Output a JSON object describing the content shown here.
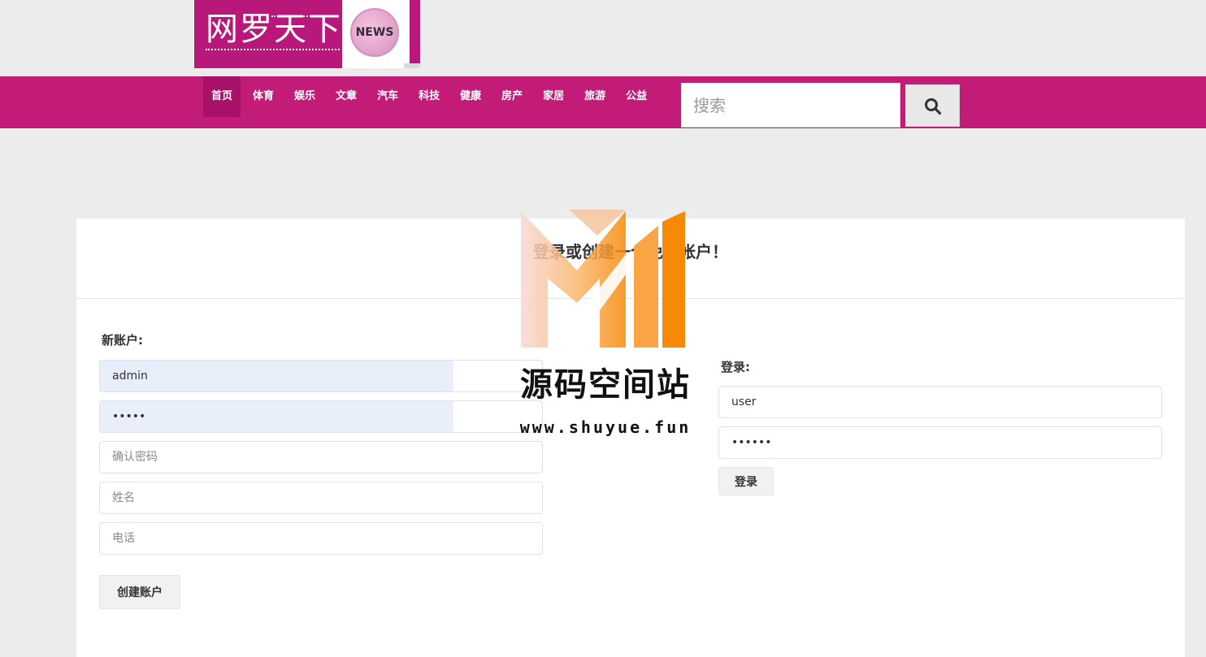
{
  "logo": {
    "title": "网罗天下",
    "badge": "NEWS"
  },
  "nav": {
    "items": [
      "首页",
      "体育",
      "娱乐",
      "文章",
      "汽车",
      "科技",
      "健康",
      "房产",
      "家居",
      "旅游",
      "公益"
    ],
    "active_index": 0
  },
  "search": {
    "placeholder": "搜索",
    "button_icon": "search-icon"
  },
  "panel": {
    "title": "登录或创建一个免费帐户！"
  },
  "register": {
    "label": "新账户:",
    "username_value": "admin",
    "password_value": "•••••",
    "confirm_placeholder": "确认密码",
    "name_placeholder": "姓名",
    "phone_placeholder": "电话",
    "submit_label": "创建账户"
  },
  "login": {
    "label": "登录:",
    "username_value": "user",
    "password_value": "••••••",
    "submit_label": "登录"
  },
  "watermark": {
    "name": "源码空间站",
    "url": "www.shuyue.fun"
  },
  "colors": {
    "brand": "#c21b78",
    "nav_active": "#a8106a",
    "background": "#ececec",
    "autofill": "#e8effa"
  }
}
